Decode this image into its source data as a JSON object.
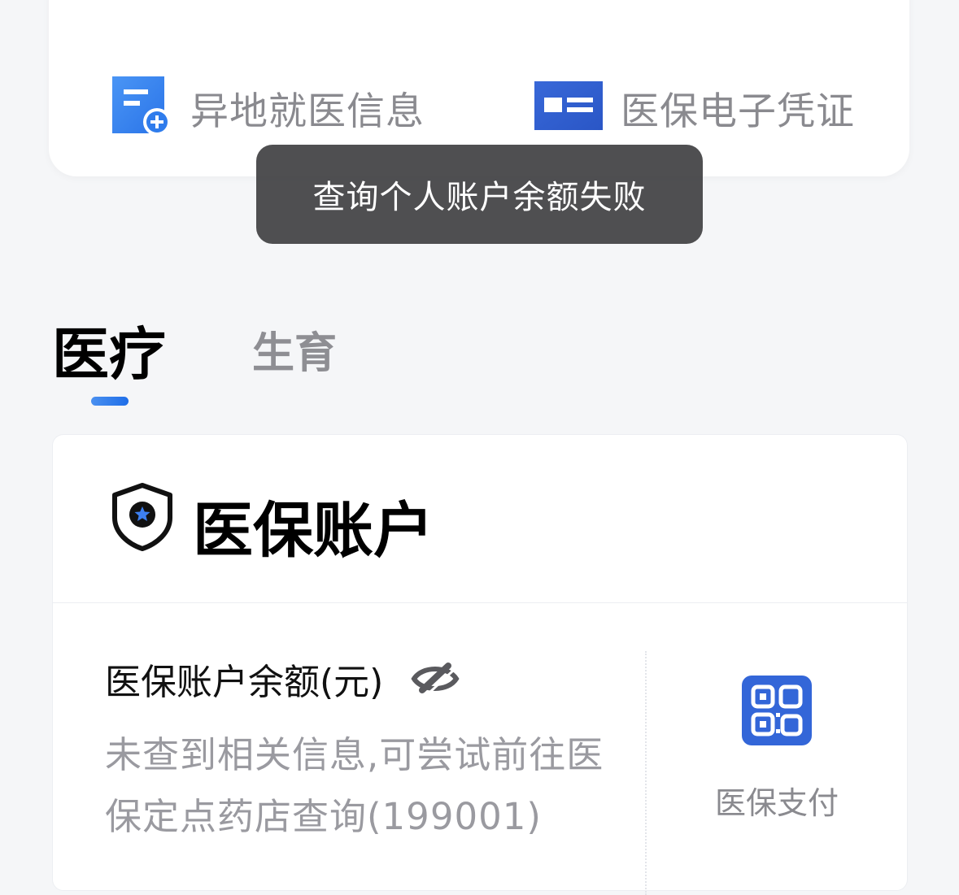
{
  "quick_links": {
    "remote_medical": {
      "label": "异地就医信息",
      "icon": "remote-medical-doc-icon"
    },
    "e_certificate": {
      "label": "医保电子凭证",
      "icon": "id-card-icon"
    }
  },
  "toast": {
    "message": "查询个人账户余额失败"
  },
  "tabs": [
    {
      "label": "医疗",
      "active": true
    },
    {
      "label": "生育",
      "active": false
    }
  ],
  "account": {
    "title": "医保账户",
    "icon": "shield-star-icon",
    "balance_label": "医保账户余额(元)",
    "visibility_icon": "eye-off-icon",
    "balance_message": "未查到相关信息,可尝试前往医保定点药店查询(199001)",
    "pay": {
      "label": "医保支付",
      "icon": "qr-code-icon"
    }
  },
  "colors": {
    "accent": "#1f6ee8",
    "background": "#f5f6f8",
    "toast_bg": "#404042"
  }
}
